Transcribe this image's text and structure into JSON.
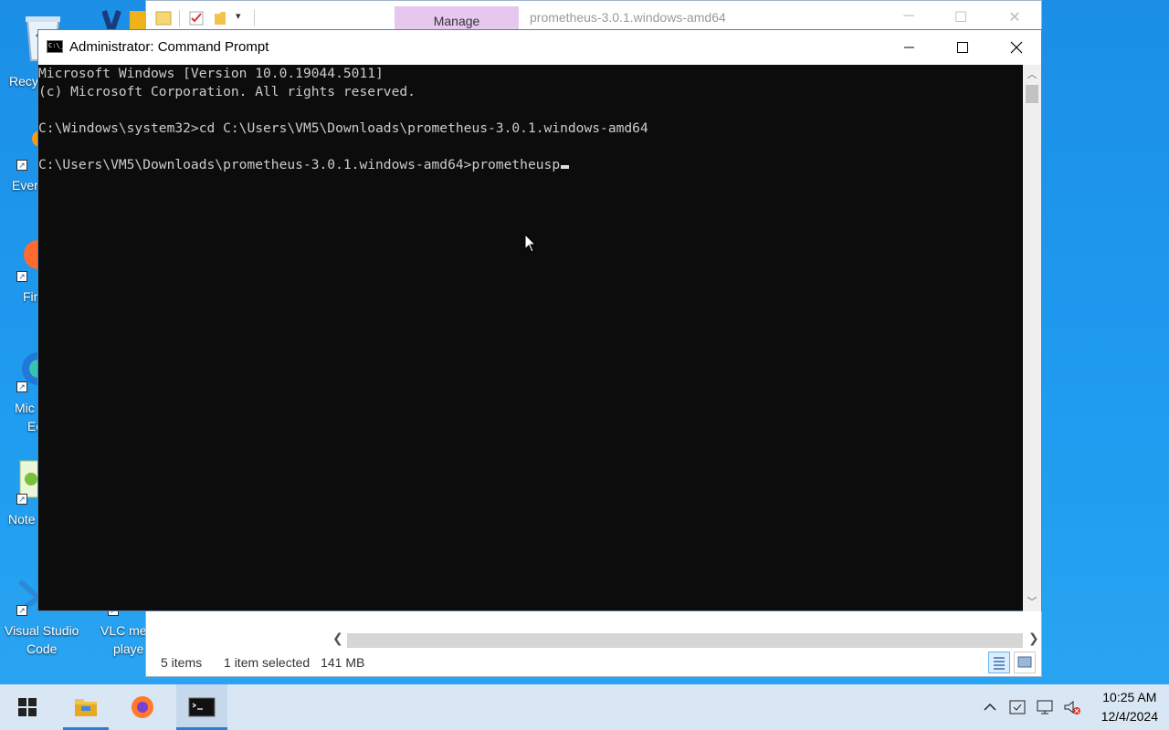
{
  "desktop": {
    "icons": [
      {
        "label": "Recy"
      },
      {
        "label": "Ever"
      },
      {
        "label": "Fir"
      },
      {
        "label": "Mic"
      },
      {
        "label": "Ec"
      },
      {
        "label": "Note"
      },
      {
        "label": "Visual Studio"
      },
      {
        "label": "Code"
      },
      {
        "label": "VLC me"
      },
      {
        "label": "playe"
      }
    ]
  },
  "explorer": {
    "manage_tab": "Manage",
    "title": "prometheus-3.0.1.windows-amd64",
    "status": {
      "items": "5 items",
      "selected": "1 item selected",
      "size": "141 MB"
    }
  },
  "cmd": {
    "title": "Administrator: Command Prompt",
    "lines": [
      "Microsoft Windows [Version 10.0.19044.5011]",
      "(c) Microsoft Corporation. All rights reserved.",
      "",
      "C:\\Windows\\system32>cd C:\\Users\\VM5\\Downloads\\prometheus-3.0.1.windows-amd64",
      "",
      "C:\\Users\\VM5\\Downloads\\prometheus-3.0.1.windows-amd64>prometheusp"
    ]
  },
  "taskbar": {
    "time": "10:25 AM",
    "date": "12/4/2024"
  },
  "colors": {
    "desktop": "#1f9bf0",
    "console_bg": "#0c0c0c",
    "console_text": "#cccccc",
    "manage_tab": "#e6c8ef",
    "taskbar": "#d9e6f3"
  }
}
